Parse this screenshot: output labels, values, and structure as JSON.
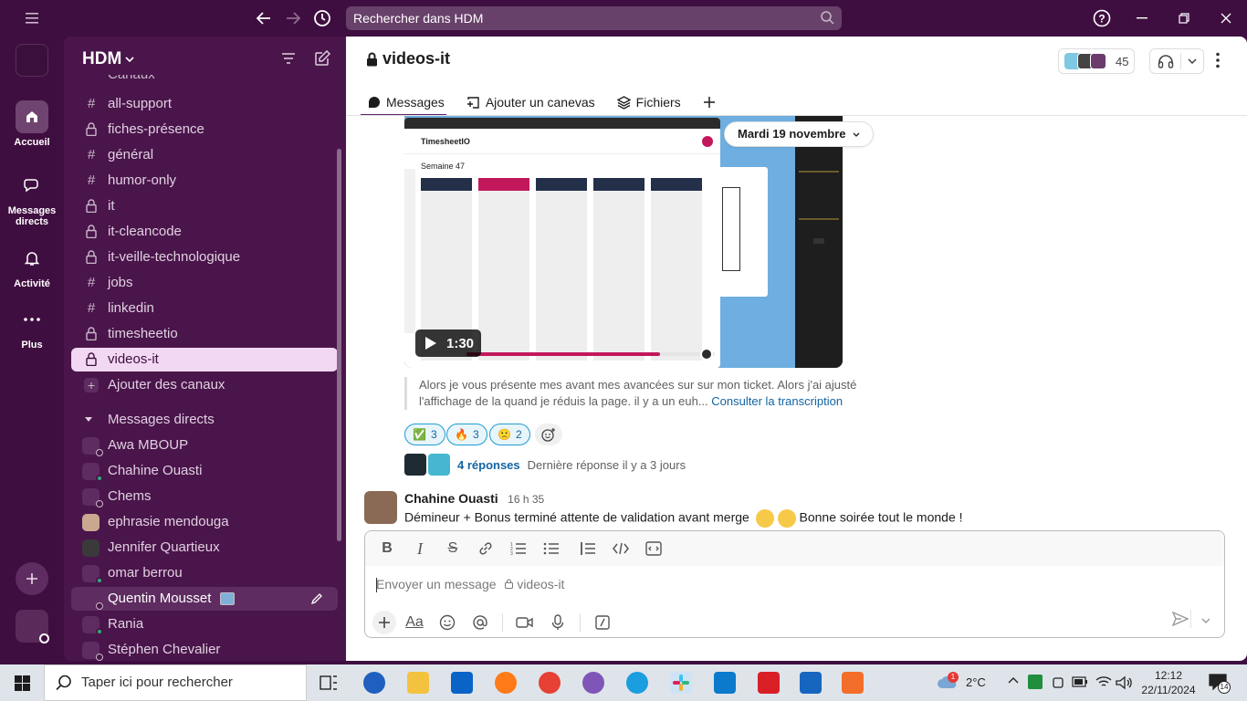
{
  "topbar": {
    "search_placeholder": "Rechercher dans HDM"
  },
  "rail": {
    "items": [
      {
        "label": "Accueil"
      },
      {
        "label": "Messages directs"
      },
      {
        "label": "Activité"
      },
      {
        "label": "Plus"
      }
    ]
  },
  "workspace": {
    "name": "HDM"
  },
  "sidebar": {
    "section_partial": "Canaux",
    "channels": [
      {
        "prefix": "#",
        "name": "all-support"
      },
      {
        "prefix": "lock",
        "name": "fiches-présence"
      },
      {
        "prefix": "#",
        "name": "général"
      },
      {
        "prefix": "#",
        "name": "humor-only"
      },
      {
        "prefix": "lock",
        "name": "it"
      },
      {
        "prefix": "lock",
        "name": "it-cleancode"
      },
      {
        "prefix": "lock",
        "name": "it-veille-technologique"
      },
      {
        "prefix": "#",
        "name": "jobs"
      },
      {
        "prefix": "#",
        "name": "linkedin"
      },
      {
        "prefix": "lock",
        "name": "timesheetio"
      },
      {
        "prefix": "lock",
        "name": "videos-it"
      }
    ],
    "add_channels": "Ajouter des canaux",
    "dm_header": "Messages directs",
    "dms": [
      {
        "name": "Awa MBOUP",
        "status": "off"
      },
      {
        "name": "Chahine Ouasti",
        "status": "on"
      },
      {
        "name": "Chems",
        "status": "off"
      },
      {
        "name": "ephrasie mendouga",
        "status": "off"
      },
      {
        "name": "Jennifer Quartieux",
        "status": "on"
      },
      {
        "name": "omar berrou",
        "status": "on"
      },
      {
        "name": "Quentin Mousset",
        "status": "off"
      },
      {
        "name": "Rania",
        "status": "on"
      },
      {
        "name": "Stéphen Chevalier",
        "status": "off"
      }
    ]
  },
  "channel": {
    "title": "videos-it",
    "member_count": "45",
    "tabs": [
      "Messages",
      "Ajouter un canevas",
      "Fichiers"
    ]
  },
  "video": {
    "duration": "1:30",
    "app_title": "TimesheetIO",
    "week_label": "Semaine 47",
    "progress": 0.78
  },
  "date_pill": "Mardi 19 novembre",
  "transcript": {
    "text": "Alors je vous présente mes avant mes avancées sur sur mon ticket. Alors j'ai ajusté l'affichage de la quand je réduis la page. il y a un euh...",
    "link": "Consulter la transcription"
  },
  "reactions": [
    {
      "emoji": "✅",
      "count": "3"
    },
    {
      "emoji": "🔥",
      "count": "3"
    },
    {
      "emoji": "🙁",
      "count": "2"
    }
  ],
  "thread": {
    "replies": "4 réponses",
    "last_reply": "Dernière réponse il y a 3 jours"
  },
  "message": {
    "author": "Chahine Ouasti",
    "time": "16 h 35",
    "text_before": "Démineur + Bonus terminé attente de validation avant merge",
    "text_after": "Bonne soirée tout le monde !"
  },
  "composer": {
    "placeholder": "Envoyer un message",
    "channel_hint": "videos-it"
  },
  "taskbar": {
    "search_placeholder": "Taper ici pour rechercher",
    "weather": "2°C",
    "time": "12:12",
    "date": "22/11/2024",
    "notifications": "14",
    "weather_badge": "1"
  },
  "colors": {
    "aubergine": "#3f0e40",
    "sidebar": "#4a154b",
    "active_channel": "#f2d8f2",
    "link": "#1264a3",
    "online": "#2bac76"
  }
}
